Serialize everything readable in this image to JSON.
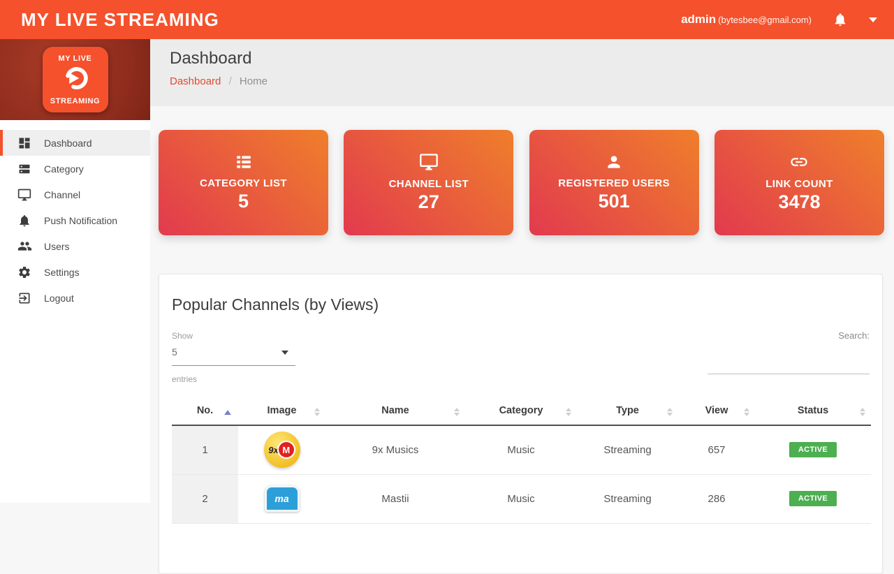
{
  "header": {
    "brand": "MY LIVE STREAMING",
    "user_name": "admin",
    "user_email": "(bytesbee@gmail.com)"
  },
  "sidebar": {
    "logo": {
      "top": "MY LIVE",
      "bottom": "STREAMING"
    },
    "items": [
      {
        "label": "Dashboard",
        "icon": "dashboard-icon",
        "active": true
      },
      {
        "label": "Category",
        "icon": "category-icon",
        "active": false
      },
      {
        "label": "Channel",
        "icon": "monitor-icon",
        "active": false
      },
      {
        "label": "Push Notification",
        "icon": "bell-icon",
        "active": false
      },
      {
        "label": "Users",
        "icon": "users-icon",
        "active": false
      },
      {
        "label": "Settings",
        "icon": "gear-icon",
        "active": false
      },
      {
        "label": "Logout",
        "icon": "logout-icon",
        "active": false
      }
    ]
  },
  "page": {
    "title": "Dashboard",
    "breadcrumb": {
      "link": "Dashboard",
      "separator": "/",
      "current": "Home"
    }
  },
  "stats": [
    {
      "label": "CATEGORY LIST",
      "value": "5",
      "icon": "list-icon"
    },
    {
      "label": "CHANNEL LIST",
      "value": "27",
      "icon": "monitor-icon"
    },
    {
      "label": "REGISTERED USERS",
      "value": "501",
      "icon": "person-icon"
    },
    {
      "label": "LINK COUNT",
      "value": "3478",
      "icon": "link-icon"
    }
  ],
  "table": {
    "title": "Popular Channels (by Views)",
    "show_label": "Show",
    "show_value": "5",
    "entries_label": "entries",
    "search_label": "Search:",
    "columns": [
      "No.",
      "Image",
      "Name",
      "Category",
      "Type",
      "View",
      "Status"
    ],
    "rows": [
      {
        "no": "1",
        "logo_left": "9x",
        "logo_right": "M",
        "name": "9x Musics",
        "category": "Music",
        "type": "Streaming",
        "view": "657",
        "status": "ACTIVE"
      },
      {
        "no": "2",
        "logo_text": "ma",
        "name": "Mastii",
        "category": "Music",
        "type": "Streaming",
        "view": "286",
        "status": "ACTIVE"
      }
    ]
  },
  "colors": {
    "accent": "#f4512c",
    "sidebar_logo_bg": "#8e2c1d",
    "card_gradient_start": "#e23a4e",
    "card_gradient_end": "#ef7f2b",
    "breadcrumb_link": "#e04a2d",
    "badge_green": "#4caf50",
    "sort_active": "#7c80c7"
  }
}
